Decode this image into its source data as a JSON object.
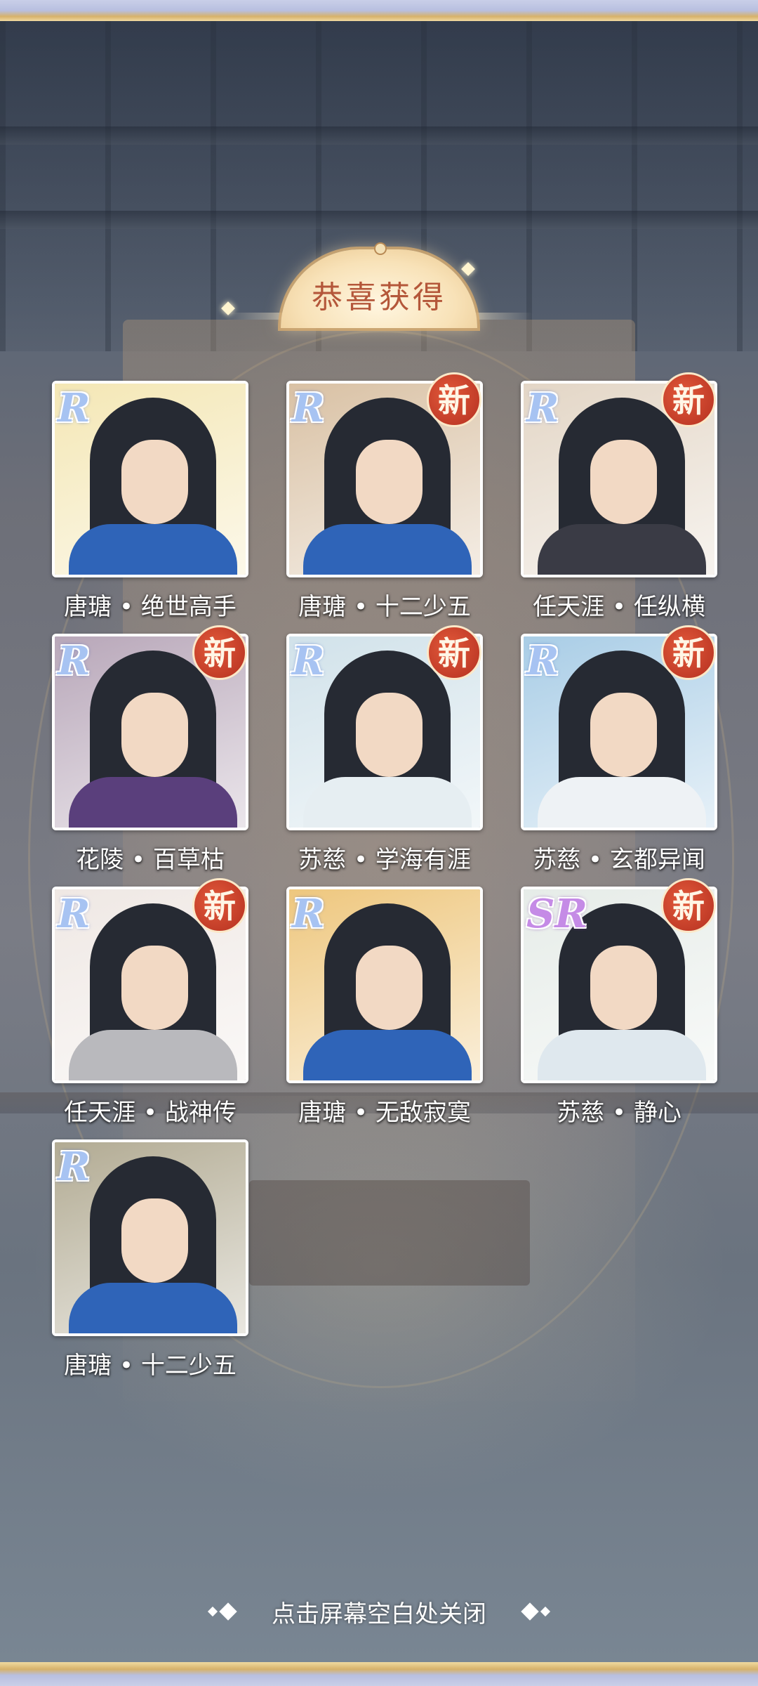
{
  "banner": {
    "title": "恭喜获得"
  },
  "cards": [
    {
      "rarity": "R",
      "is_new": false,
      "label": "唐瑭 • 绝世高手",
      "bg": "#f4e7b5",
      "robe": "#2f64b8"
    },
    {
      "rarity": "R",
      "is_new": true,
      "new_text": "新",
      "label": "唐瑭 • 十二少五",
      "bg": "#d9c1a4",
      "robe": "#2f64b8"
    },
    {
      "rarity": "R",
      "is_new": true,
      "new_text": "新",
      "label": "任天涯 • 任纵横",
      "bg": "#e3d6c6",
      "robe": "#3a3b45"
    },
    {
      "rarity": "R",
      "is_new": true,
      "new_text": "新",
      "label": "花陵 • 百草枯",
      "bg": "#b8a7b9",
      "robe": "#5a3f7c"
    },
    {
      "rarity": "R",
      "is_new": true,
      "new_text": "新",
      "label": "苏慈 • 学海有涯",
      "bg": "#d1e2ea",
      "robe": "#e6eef2"
    },
    {
      "rarity": "R",
      "is_new": true,
      "new_text": "新",
      "label": "苏慈 • 玄都异闻",
      "bg": "#a9cde6",
      "robe": "#eef2f5"
    },
    {
      "rarity": "R",
      "is_new": true,
      "new_text": "新",
      "label": "任天涯 • 战神传",
      "bg": "#efe8e4",
      "robe": "#b9b9bd"
    },
    {
      "rarity": "R",
      "is_new": false,
      "label": "唐瑭 • 无敌寂寞",
      "bg": "#eec77e",
      "robe": "#2f64b8"
    },
    {
      "rarity": "SR",
      "is_new": true,
      "new_text": "新",
      "label": "苏慈 • 静心",
      "bg": "#e6ece8",
      "robe": "#dfe8ee"
    },
    {
      "rarity": "R",
      "is_new": false,
      "label": "唐瑭 • 十二少五",
      "bg": "#b2ab93",
      "robe": "#2f64b8"
    }
  ],
  "footer": {
    "close_hint": "点击屏幕空白处关闭"
  }
}
